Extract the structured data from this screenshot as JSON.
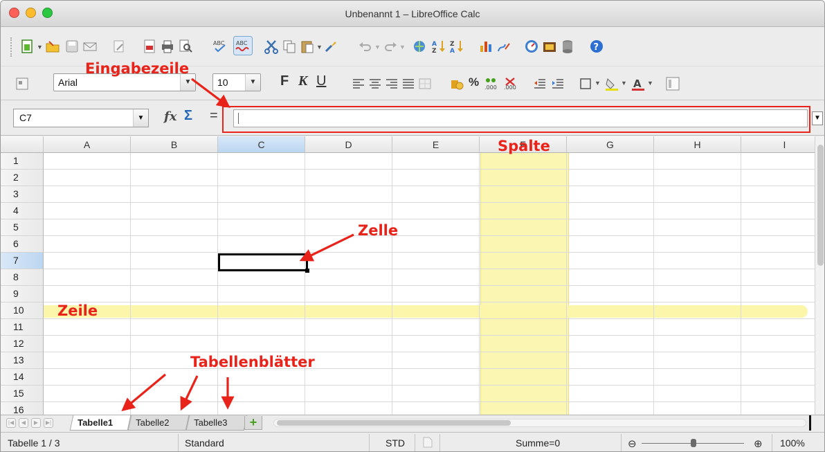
{
  "window": {
    "title": "Unbenannt 1 – LibreOffice Calc"
  },
  "toolbar": {
    "font_name": "Arial",
    "font_size": "10",
    "bold_label": "F",
    "italic_label": "K",
    "underline_label": "U",
    "percent_label": "%",
    "icons_row1": [
      "new-document-icon",
      "open-folder-icon",
      "save-icon",
      "email-icon",
      "edit-file-icon",
      "export-pdf-icon",
      "print-icon",
      "page-preview-icon",
      "spellcheck-icon",
      "autospellcheck-icon",
      "cut-icon",
      "copy-icon",
      "paste-icon",
      "clone-formatting-icon",
      "undo-icon",
      "redo-icon",
      "hyperlink-icon",
      "sort-ascending-icon",
      "sort-descending-icon",
      "chart-icon",
      "draw-functions-icon",
      "navigator-icon",
      "gallery-icon",
      "data-sources-icon",
      "help-icon"
    ],
    "icons_row2": [
      "styles-icon",
      "align-left-icon",
      "align-center-icon",
      "align-right-icon",
      "justify-icon",
      "merge-cells-icon",
      "currency-icon",
      "percent-icon",
      "add-decimal-icon",
      "delete-decimal-icon",
      "decrease-indent-icon",
      "increase-indent-icon",
      "borders-icon",
      "background-color-icon",
      "font-color-icon",
      "show-draw-icon"
    ]
  },
  "formula_bar": {
    "name_box": "C7",
    "function_wizard_icon": "fx",
    "sum_icon": "Σ",
    "equals_label": "=",
    "input_value": ""
  },
  "grid": {
    "columns": [
      "A",
      "B",
      "C",
      "D",
      "E",
      "F",
      "G",
      "H",
      "I"
    ],
    "rows": [
      "1",
      "2",
      "3",
      "4",
      "5",
      "6",
      "7",
      "8",
      "9",
      "10",
      "11",
      "12",
      "13",
      "14",
      "15",
      "16"
    ],
    "selected_column": "C",
    "selected_row": "7",
    "selected_cell": "C7"
  },
  "sheets": {
    "tabs": [
      "Tabelle1",
      "Tabelle2",
      "Tabelle3"
    ],
    "active": "Tabelle1",
    "add_label": "+"
  },
  "status": {
    "sheet_position": "Tabelle 1 / 3",
    "page_style": "Standard",
    "selection_mode": "STD",
    "sum": "Summe=0",
    "zoom": "100%",
    "zoom_out": "⊖",
    "zoom_in": "⊕"
  },
  "annotations": {
    "eingabezeile": "Eingabezeile",
    "spalte": "Spalte",
    "zelle": "Zelle",
    "zeile": "Zeile",
    "tabellenblaetter": "Tabellenblätter",
    "color": "#e8231a"
  },
  "colors": {
    "highlight_yellow": "#fbf6a9",
    "selection_blue": "#bcd6f1"
  }
}
